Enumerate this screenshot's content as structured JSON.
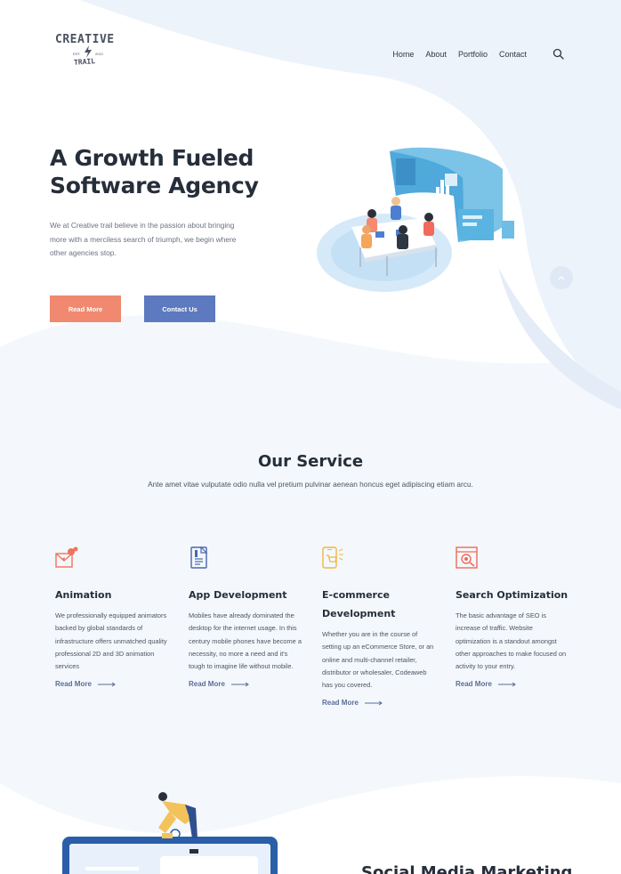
{
  "brand": {
    "name": "CREATIVE",
    "tagline": "TRAIL",
    "est": "EST.",
    "year": "2012"
  },
  "nav": {
    "items": [
      "Home",
      "About",
      "Portfolio",
      "Contact"
    ],
    "search_icon": "search-icon"
  },
  "hero": {
    "title_line1": "A Growth Fueled",
    "title_line2": "Software Agency",
    "text": "We at Creative trail believe in the passion about bringing more with a merciless search of triumph, we begin where other agencies stop.",
    "read_more": "Read More",
    "contact": "Contact Us"
  },
  "services": {
    "title": "Our Service",
    "subtitle": "Ante amet vitae vulputate odio nulla vel pretium pulvinar aenean honcus eget adipiscing etiam arcu.",
    "items": [
      {
        "title": "Animation",
        "icon": "animation-icon",
        "text": "We professionally equipped animators backed by global standards of infrastructure offers unmatched quality professional 2D and 3D animation services",
        "link": "Read More"
      },
      {
        "title": "App Development",
        "icon": "app-development-icon",
        "text": "Mobiles have already dominated the desktop for the internet usage. In this century mobile phones have become a necessity, no more a need and it's tough to imagine life without mobile.",
        "link": "Read More"
      },
      {
        "title": "E-commerce Development",
        "icon": "ecommerce-icon",
        "text": "Whether you are in the course of setting up an eCommerce Store, or an online and multi-channel retailer, distributor or wholesaler, Codeaweb has you covered.",
        "link": "Read More"
      },
      {
        "title": "Search Optimization",
        "icon": "seo-icon",
        "text": "The basic advantage of SEO is increase of traffic. Website optimization is a standout amongst other approaches to make focused on activity to your entry.",
        "link": "Read More"
      }
    ]
  },
  "next_section": {
    "title": "Social Media Marketing"
  },
  "colors": {
    "accent_orange": "#f0896f",
    "accent_blue": "#5d79bf",
    "bg_light": "#f4f8fc",
    "link": "#5b6c98"
  }
}
